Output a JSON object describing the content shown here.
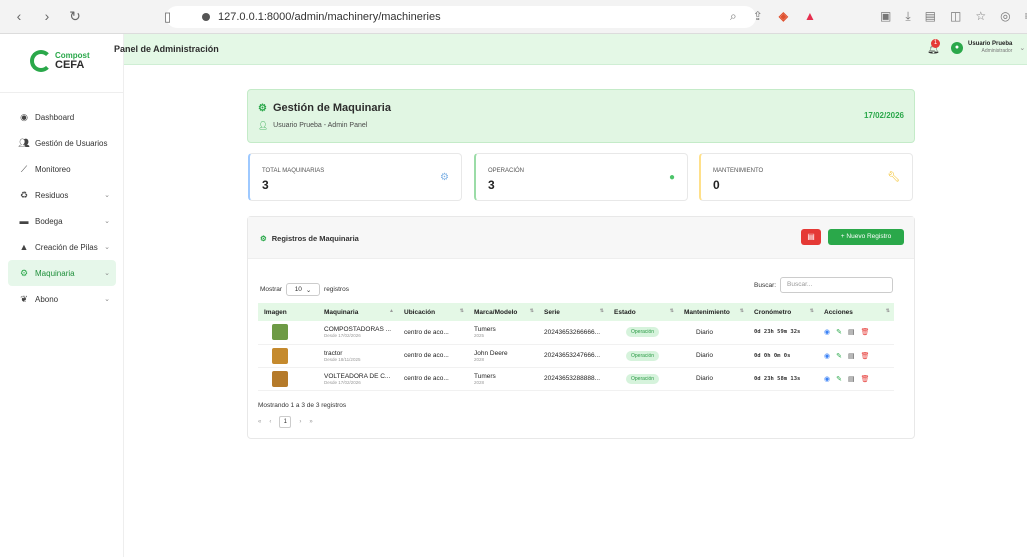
{
  "browser": {
    "url": "127.0.0.1:8000/admin/machinery/machineries"
  },
  "sidebar": {
    "logo_top": "Compost",
    "logo_bottom": "CEFA",
    "items": [
      {
        "label": "Dashboard",
        "icon": "gauge-icon",
        "chevron": false,
        "active": false
      },
      {
        "label": "Gestión de Usuarios",
        "icon": "users-icon",
        "chevron": false,
        "active": false
      },
      {
        "label": "Monitoreo",
        "icon": "chart-icon",
        "chevron": false,
        "active": false
      },
      {
        "label": "Residuos",
        "icon": "recycle-icon",
        "chevron": true,
        "active": false
      },
      {
        "label": "Bodega",
        "icon": "warehouse-icon",
        "chevron": true,
        "active": false
      },
      {
        "label": "Creación de Pilas",
        "icon": "pile-icon",
        "chevron": true,
        "active": false
      },
      {
        "label": "Maquinaria",
        "icon": "cogs-icon",
        "chevron": true,
        "active": true
      },
      {
        "label": "Abono",
        "icon": "seedling-icon",
        "chevron": true,
        "active": false
      }
    ]
  },
  "header": {
    "title": "Panel de Administración",
    "notification_count": "1",
    "user_name": "Usuario Prueba",
    "user_role": "Administrador"
  },
  "banner": {
    "title": "Gestión de Maquinaria",
    "subtitle": "Usuario Prueba - Admin Panel",
    "date": "17/02/2026"
  },
  "stats": [
    {
      "label": "TOTAL MAQUINARIAS",
      "value": "3",
      "color": "#9ec9ff"
    },
    {
      "label": "OPERACIÓN",
      "value": "3",
      "color": "#9bdca7"
    },
    {
      "label": "MANTENIMIENTO",
      "value": "0",
      "color": "#ffe08a"
    }
  ],
  "records": {
    "title": "Registros de Maquinaria",
    "new_button": "Nuevo Registro",
    "show_label": "Mostrar",
    "show_value": "10",
    "records_label": "registros",
    "search_label": "Buscar:",
    "search_placeholder": "Buscar...",
    "columns": [
      "Imagen",
      "Maquinaria",
      "Ubicación",
      "Marca/Modelo",
      "Serie",
      "Estado",
      "Mantenimiento",
      "Cronómetro",
      "Acciones"
    ],
    "rows": [
      {
        "machine": "COMPOSTADORAS ...",
        "since": "Desde 17/02/2026",
        "location": "centro de aco...",
        "brand": "Tumers",
        "model": "2025",
        "serial": "20243653266666...",
        "status": "Operación",
        "maintenance": "Diario",
        "timer": "0d 23h 59m 32s",
        "thumb": "#6d9a45"
      },
      {
        "machine": "tractor",
        "since": "Desde 18/11/2025",
        "location": "centro de aco...",
        "brand": "John Deere",
        "model": "2028",
        "serial": "20243653247666...",
        "status": "Operación",
        "maintenance": "Diario",
        "timer": "0d 0h 0m 0s",
        "thumb": "#c58a2d"
      },
      {
        "machine": "VOLTEADORA DE C...",
        "since": "Desde 17/02/2026",
        "location": "centro de aco...",
        "brand": "Tumers",
        "model": "2028",
        "serial": "20243653288888...",
        "status": "Operación",
        "maintenance": "Diario",
        "timer": "0d 23h 58m 13s",
        "thumb": "#b57a2a"
      }
    ],
    "footer_info": "Mostrando 1 a 3 de 3 registros",
    "pager": {
      "first": "«",
      "prev": "‹",
      "page": "1",
      "next": "›",
      "last": "»"
    }
  }
}
